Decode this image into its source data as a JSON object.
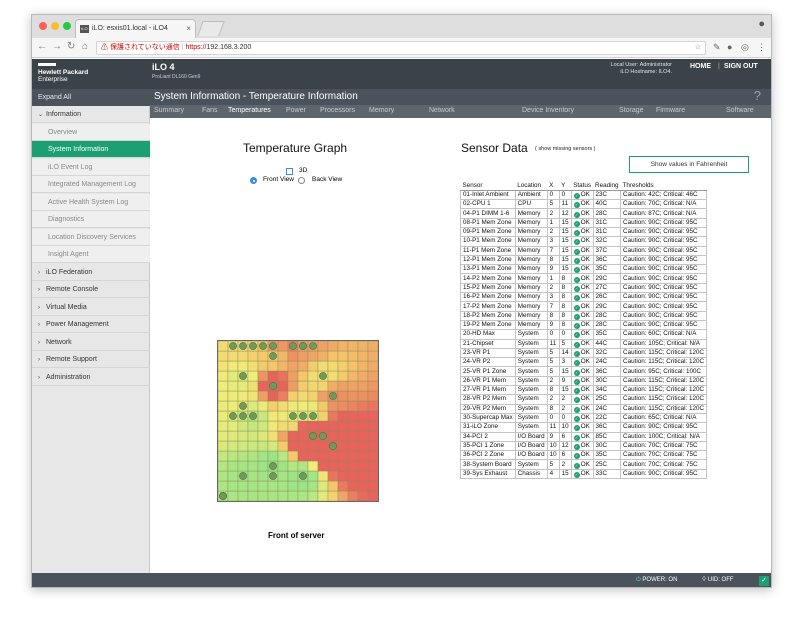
{
  "browser": {
    "tab_title": "iLO: esxis01.local - iLO4",
    "tab_favicon": "iLO",
    "url_warning": "⚠ 保護されていない通信",
    "url_scheme": "https://",
    "url_host": "192.168.3.200",
    "account_icon": "account-circle-icon"
  },
  "header": {
    "brand_line1": "Hewlett Packard",
    "brand_line2": "Enterprise",
    "product": "iLO 4",
    "server_model": "ProLiant DL160 Gen9",
    "user_line1": "Local User: Administrator",
    "user_line2": "iLO Hostname: ILO4.",
    "home": "HOME",
    "separator": "|",
    "signout": "SIGN OUT"
  },
  "sidebar": {
    "expand": "Expand All",
    "items": [
      {
        "label": "Information",
        "chevron": "⌄",
        "sub": false,
        "active": false
      },
      {
        "label": "Overview",
        "sub": true,
        "active": false
      },
      {
        "label": "System Information",
        "sub": true,
        "active": true
      },
      {
        "label": "iLO Event Log",
        "sub": true,
        "active": false
      },
      {
        "label": "Integrated Management Log",
        "sub": true,
        "active": false
      },
      {
        "label": "Active Health System Log",
        "sub": true,
        "active": false
      },
      {
        "label": "Diagnostics",
        "sub": true,
        "active": false
      },
      {
        "label": "Location Discovery Services",
        "sub": true,
        "active": false
      },
      {
        "label": "Insight Agent",
        "sub": true,
        "active": false
      },
      {
        "label": "iLO Federation",
        "chevron": "›",
        "sub": false,
        "active": false
      },
      {
        "label": "Remote Console",
        "chevron": "›",
        "sub": false,
        "active": false
      },
      {
        "label": "Virtual Media",
        "chevron": "›",
        "sub": false,
        "active": false
      },
      {
        "label": "Power Management",
        "chevron": "›",
        "sub": false,
        "active": false
      },
      {
        "label": "Network",
        "chevron": "›",
        "sub": false,
        "active": false
      },
      {
        "label": "Remote Support",
        "chevron": "›",
        "sub": false,
        "active": false
      },
      {
        "label": "Administration",
        "chevron": "›",
        "sub": false,
        "active": false
      }
    ]
  },
  "page": {
    "title": "System Information - Temperature Information",
    "help": "?"
  },
  "tabs": [
    "Summary",
    "Fans",
    "Temperatures",
    "Power",
    "Processors",
    "Memory",
    "Network",
    "Device Inventory",
    "Storage",
    "Firmware",
    "Software"
  ],
  "active_tab": "Temperatures",
  "graph": {
    "title": "Temperature Graph",
    "checkbox_3d": "3D",
    "front_view": "Front View",
    "back_view": "Back View",
    "caption": "Front of server"
  },
  "sensors": {
    "title": "Sensor Data",
    "missing_link": "( show missing sensors )",
    "fahrenheit_button": "Show values in Fahrenheit",
    "columns": [
      "Sensor",
      "Location",
      "X",
      "Y",
      "Status",
      "Reading",
      "Thresholds"
    ],
    "rows": [
      [
        "01-Inlet Ambient",
        "Ambient",
        "0",
        "0",
        "OK",
        "23C",
        "Caution: 42C; Critical: 46C"
      ],
      [
        "02-CPU 1",
        "CPU",
        "5",
        "11",
        "OK",
        "40C",
        "Caution: 70C; Critical: N/A"
      ],
      [
        "04-P1 DIMM 1-6",
        "Memory",
        "2",
        "12",
        "OK",
        "28C",
        "Caution: 87C; Critical: N/A"
      ],
      [
        "08-P1 Mem Zone",
        "Memory",
        "1",
        "15",
        "OK",
        "31C",
        "Caution: 90C; Critical: 95C"
      ],
      [
        "09-P1 Mem Zone",
        "Memory",
        "2",
        "15",
        "OK",
        "31C",
        "Caution: 90C; Critical: 95C"
      ],
      [
        "10-P1 Mem Zone",
        "Memory",
        "3",
        "15",
        "OK",
        "32C",
        "Caution: 90C; Critical: 95C"
      ],
      [
        "11-P1 Mem Zone",
        "Memory",
        "7",
        "15",
        "OK",
        "37C",
        "Caution: 90C; Critical: 95C"
      ],
      [
        "12-P1 Mem Zone",
        "Memory",
        "8",
        "15",
        "OK",
        "36C",
        "Caution: 90C; Critical: 95C"
      ],
      [
        "13-P1 Mem Zone",
        "Memory",
        "9",
        "15",
        "OK",
        "35C",
        "Caution: 90C; Critical: 95C"
      ],
      [
        "14-P2 Mem Zone",
        "Memory",
        "1",
        "8",
        "OK",
        "29C",
        "Caution: 90C; Critical: 95C"
      ],
      [
        "15-P2 Mem Zone",
        "Memory",
        "2",
        "8",
        "OK",
        "27C",
        "Caution: 90C; Critical: 95C"
      ],
      [
        "16-P2 Mem Zone",
        "Memory",
        "3",
        "8",
        "OK",
        "26C",
        "Caution: 90C; Critical: 95C"
      ],
      [
        "17-P2 Mem Zone",
        "Memory",
        "7",
        "8",
        "OK",
        "29C",
        "Caution: 90C; Critical: 95C"
      ],
      [
        "18-P2 Mem Zone",
        "Memory",
        "8",
        "8",
        "OK",
        "28C",
        "Caution: 90C; Critical: 95C"
      ],
      [
        "19-P2 Mem Zone",
        "Memory",
        "9",
        "8",
        "OK",
        "28C",
        "Caution: 90C; Critical: 95C"
      ],
      [
        "20-HD Max",
        "System",
        "0",
        "0",
        "OK",
        "35C",
        "Caution: 60C; Critical: N/A"
      ],
      [
        "21-Chipset",
        "System",
        "11",
        "5",
        "OK",
        "44C",
        "Caution: 105C; Critical: N/A"
      ],
      [
        "23-VR P1",
        "System",
        "5",
        "14",
        "OK",
        "32C",
        "Caution: 115C; Critical: 120C"
      ],
      [
        "24-VR P2",
        "System",
        "5",
        "3",
        "OK",
        "24C",
        "Caution: 115C; Critical: 120C"
      ],
      [
        "25-VR P1 Zone",
        "System",
        "5",
        "15",
        "OK",
        "36C",
        "Caution: 95C; Critical: 100C"
      ],
      [
        "26-VR P1 Mem",
        "System",
        "2",
        "9",
        "OK",
        "30C",
        "Caution: 115C; Critical: 120C"
      ],
      [
        "27-VR P1 Mem",
        "System",
        "8",
        "15",
        "OK",
        "34C",
        "Caution: 115C; Critical: 120C"
      ],
      [
        "28-VR P2 Mem",
        "System",
        "2",
        "2",
        "OK",
        "25C",
        "Caution: 115C; Critical: 120C"
      ],
      [
        "29-VR P2 Mem",
        "System",
        "8",
        "2",
        "OK",
        "24C",
        "Caution: 115C; Critical: 120C"
      ],
      [
        "30-Supercap Max",
        "System",
        "0",
        "0",
        "OK",
        "22C",
        "Caution: 65C; Critical: N/A"
      ],
      [
        "31-iLO Zone",
        "System",
        "11",
        "10",
        "OK",
        "36C",
        "Caution: 90C; Critical: 95C"
      ],
      [
        "34-PCI 2",
        "I/O Board",
        "9",
        "6",
        "OK",
        "85C",
        "Caution: 100C; Critical: N/A"
      ],
      [
        "35-PCI 1 Zone",
        "I/O Board",
        "10",
        "12",
        "OK",
        "30C",
        "Caution: 70C; Critical: 75C"
      ],
      [
        "36-PCI 2 Zone",
        "I/O Board",
        "10",
        "6",
        "OK",
        "35C",
        "Caution: 70C; Critical: 75C"
      ],
      [
        "38-System Board",
        "System",
        "5",
        "2",
        "OK",
        "25C",
        "Caution: 70C; Critical: 75C"
      ],
      [
        "39-Sys Exhaust",
        "Chassis",
        "4",
        "15",
        "OK",
        "33C",
        "Caution: 90C; Critical: 95C"
      ]
    ]
  },
  "footer": {
    "power": "POWER: ON",
    "uid": "UID: OFF"
  },
  "colors": {
    "accent": "#1d9f74",
    "header": "#3b434a",
    "bar": "#4a535b",
    "heat_hot": "#e8635c",
    "heat_warm": "#f4c66a",
    "heat_cool": "#6fe08e"
  }
}
